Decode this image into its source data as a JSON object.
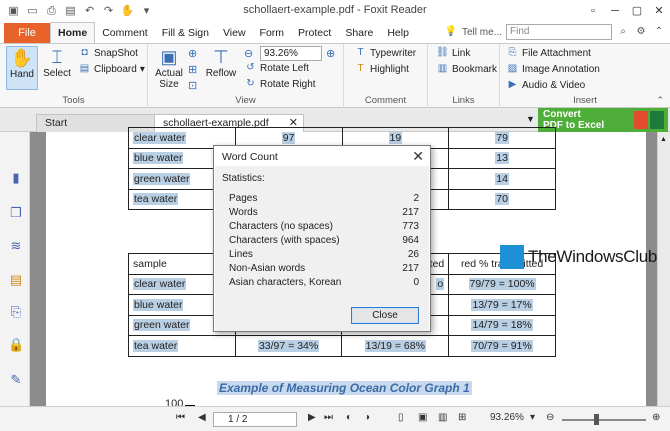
{
  "app": {
    "title": "schollaert-example.pdf - Foxit Reader"
  },
  "quick_access": [
    "folder-icon",
    "open-icon",
    "print-icon",
    "save-icon",
    "undo-icon",
    "redo-icon",
    "hand-tool-icon",
    "customize-icon"
  ],
  "menu": {
    "file": "File",
    "items": [
      "Home",
      "Comment",
      "Fill & Sign",
      "View",
      "Form",
      "Protect",
      "Share",
      "Help"
    ],
    "tell_me": "Tell me...",
    "find_placeholder": "Find"
  },
  "ribbon": {
    "tools": {
      "hand": "Hand",
      "select": "Select",
      "snapshot": "SnapShot",
      "clipboard": "Clipboard",
      "label": "Tools"
    },
    "view": {
      "actual_size_1": "Actual",
      "actual_size_2": "Size",
      "reflow": "Reflow",
      "zoom": "93.26%",
      "rotate_left": "Rotate Left",
      "rotate_right": "Rotate Right",
      "label": "View"
    },
    "comment": {
      "typewriter": "Typewriter",
      "highlight": "Highlight",
      "label": "Comment"
    },
    "links": {
      "link": "Link",
      "bookmark": "Bookmark",
      "label": "Links"
    },
    "insert": {
      "file_attachment": "File Attachment",
      "image_annotation": "Image Annotation",
      "audio_video": "Audio & Video",
      "label": "Insert"
    }
  },
  "tabs": {
    "start": "Start",
    "doc": "schollaert-example.pdf"
  },
  "convert": {
    "line1": "Convert",
    "line2": "PDF to Excel"
  },
  "top_table": [
    [
      "clear water",
      "97",
      "19",
      "79"
    ],
    [
      "blue water",
      "",
      "",
      "13"
    ],
    [
      "green water",
      "",
      "",
      "14"
    ],
    [
      "tea water",
      "",
      "",
      "70"
    ]
  ],
  "bottom_table": {
    "header": [
      "sample",
      "",
      "tted",
      "red % transmitted"
    ],
    "rows": [
      [
        "clear water",
        "",
        "o",
        "79/79 = 100%"
      ],
      [
        "blue water",
        "",
        "",
        "13/79 = 17%"
      ],
      [
        "green water",
        "",
        "",
        "14/79 = 18%"
      ],
      [
        "tea water",
        "33/97 = 34%",
        "13/19 = 68%",
        "70/79 = 91%"
      ]
    ]
  },
  "graph_title": "Example of Measuring Ocean Color Graph 1",
  "graph_axis_top": "100",
  "watermark": "TheWindowsClub",
  "dialog": {
    "title": "Word Count",
    "statistics_label": "Statistics:",
    "stats": [
      {
        "label": "Pages",
        "value": "2"
      },
      {
        "label": "Words",
        "value": "217"
      },
      {
        "label": "Characters (no spaces)",
        "value": "773"
      },
      {
        "label": "Characters (with spaces)",
        "value": "964"
      },
      {
        "label": "Lines",
        "value": "26"
      },
      {
        "label": "Non-Asian words",
        "value": "217"
      },
      {
        "label": "Asian characters, Korean",
        "value": "0"
      }
    ],
    "close_label": "Close"
  },
  "status": {
    "page": "1 / 2",
    "zoom": "93.26%"
  }
}
